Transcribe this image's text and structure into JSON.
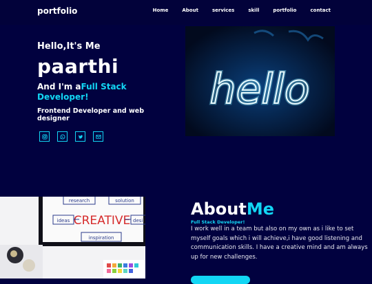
{
  "nav": {
    "brand": "portfolio",
    "links": [
      "Home",
      "About",
      "services",
      "skill",
      "portfolio",
      "contact"
    ]
  },
  "hero": {
    "greeting": "Hello,It's Me",
    "name": "paarthi",
    "role_prefix": "And I'm a",
    "role_accent": "Full Stack Developer!",
    "description": "Frontend Developer and web designer",
    "socials": [
      "instagram-icon",
      "whatsapp-icon",
      "twitter-icon",
      "mail-icon"
    ],
    "image_text": "hello"
  },
  "about": {
    "title_prefix": "About",
    "title_accent": "Me",
    "subtitle": "Full Stack Developer!",
    "text": "I work well in a team but also on my own as i like to set myself goals which i will achieve,i have good listening and communication skills. I have a creative mind and am always up for new challenges.",
    "image_words": [
      "research",
      "solution",
      "ideas",
      "CREATIVE",
      "desi",
      "inspiration"
    ]
  },
  "colors": {
    "background": "#01013f",
    "accent": "#12d6f4"
  }
}
